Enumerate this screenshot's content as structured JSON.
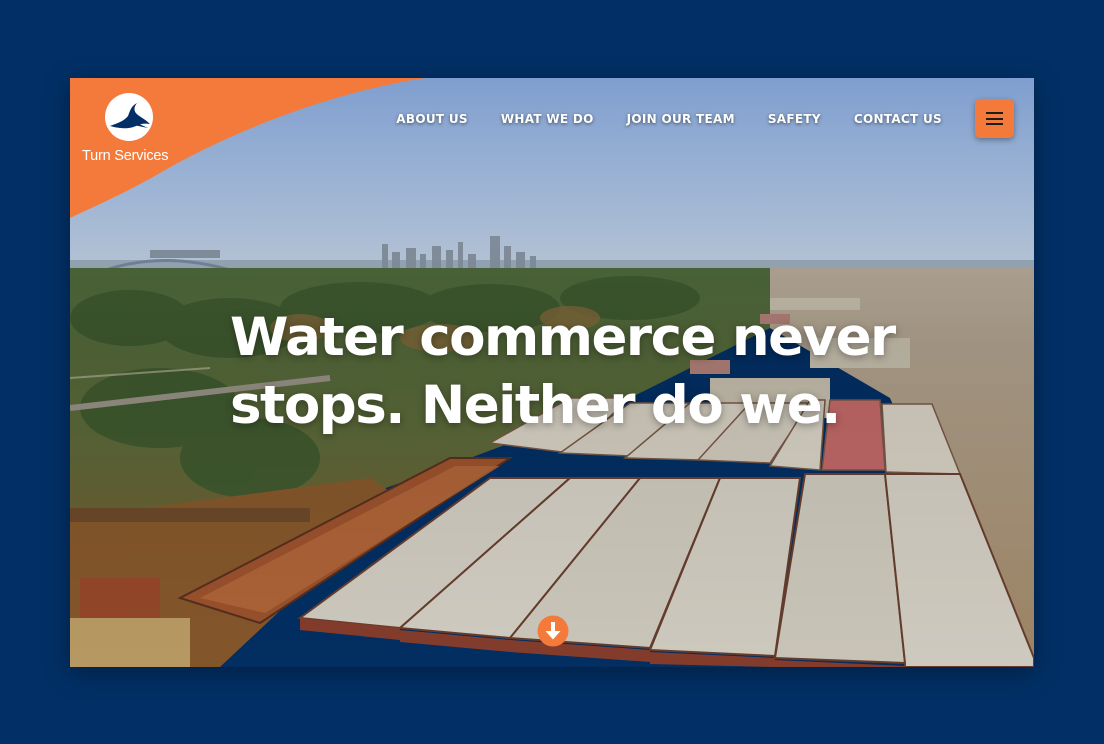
{
  "brand": {
    "name": "Turn Services",
    "logo_icon": "bird-circle-icon",
    "accent_color": "#f47a3c",
    "navy_color": "#023066"
  },
  "nav": {
    "items": [
      {
        "label": "ABOUT US"
      },
      {
        "label": "WHAT WE DO"
      },
      {
        "label": "JOIN OUR TEAM"
      },
      {
        "label": "SAFETY"
      },
      {
        "label": "CONTACT US"
      }
    ],
    "menu_icon": "hamburger-icon"
  },
  "hero": {
    "headline_line1": "Water commerce never",
    "headline_line2": "stops. Neither do we.",
    "scroll_icon": "arrow-down-icon"
  }
}
